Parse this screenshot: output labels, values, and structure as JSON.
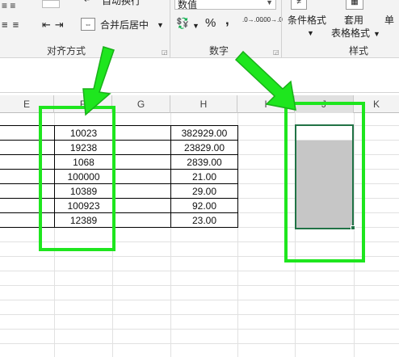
{
  "ribbon": {
    "wrap_text": "自动换行",
    "merge_center": "合并后居中",
    "alignment_label": "对齐方式",
    "number_format_value": "数值",
    "percent": "%",
    "comma": ",",
    "inc_decimal": ".0→.00",
    "dec_decimal": ".00→.0",
    "number_label": "数字",
    "conditional_format": "条件格式",
    "table_format_line1": "套用",
    "table_format_line2": "表格格式",
    "cell_styles": "单",
    "styles_label": "样式"
  },
  "columns": [
    "E",
    "F",
    "G",
    "H",
    "I",
    "J",
    "K"
  ],
  "data": {
    "col_f": [
      "10023",
      "19238",
      "1068",
      "100000",
      "10389",
      "100923",
      "12389"
    ],
    "col_h": [
      "382929.00",
      "23829.00",
      "2839.00",
      "21.00",
      "29.00",
      "92.00",
      "23.00"
    ]
  },
  "colors": {
    "highlight_green": "#1ee61e",
    "selection_border": "#217346",
    "selection_fill": "#c6c6c6"
  }
}
